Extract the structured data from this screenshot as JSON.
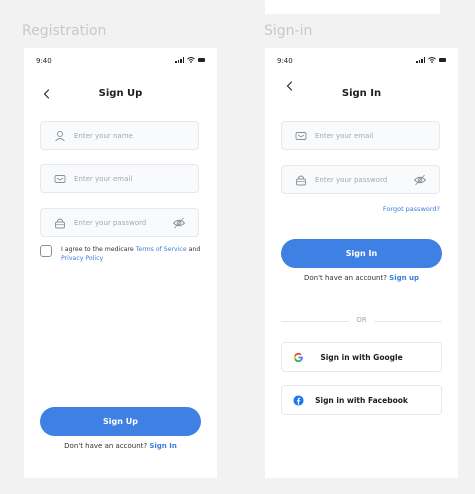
{
  "sections": {
    "registration": "Registration",
    "signin": "Sign-in"
  },
  "colors": {
    "primary": "#3f80e4",
    "link": "#3b7ddd",
    "background": "#f2f2f2"
  },
  "signup": {
    "status_time": "9:40",
    "title": "Sign Up",
    "name_placeholder": "Enter your name",
    "email_placeholder": "Enter your email",
    "password_placeholder": "Enter your password",
    "agree_prefix": "I agree to the medicare ",
    "terms_link": "Terms of Service",
    "agree_and": " and ",
    "privacy_link": "Privacy Policy",
    "button": "Sign Up",
    "footer_text": "Don't have an account? ",
    "footer_link": "Sign In"
  },
  "signin": {
    "status_time": "9:40",
    "title": "Sign In",
    "email_placeholder": "Enter your email",
    "password_placeholder": "Enter your password",
    "forgot": "Forgot password?",
    "button": "Sign In",
    "footer_text": "Don't have an account? ",
    "footer_link": "Sign up",
    "or": "OR",
    "google": "Sign in with Google",
    "facebook": "Sign in with Facebook"
  },
  "icons": {
    "back": "chevron-left-icon",
    "user": "user-icon",
    "mail": "mail-icon",
    "lock": "lock-icon",
    "eye_off": "eye-off-icon",
    "google": "google-icon",
    "facebook": "facebook-icon"
  }
}
